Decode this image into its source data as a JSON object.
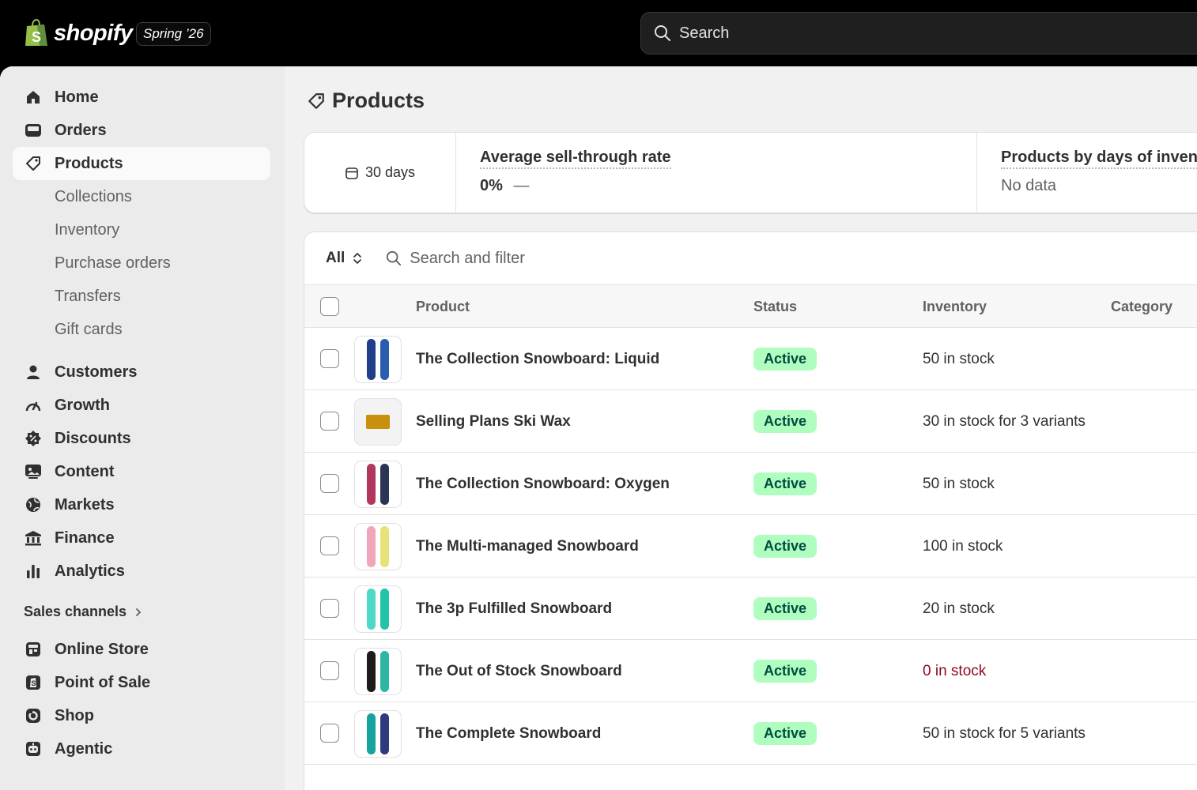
{
  "topbar": {
    "brand": "shopify",
    "edition": "Spring ’26",
    "search_placeholder": "Search"
  },
  "sidebar": {
    "primary": [
      {
        "label": "Home",
        "icon": "home-icon"
      },
      {
        "label": "Orders",
        "icon": "inbox-icon"
      },
      {
        "label": "Products",
        "icon": "tag-icon",
        "active": true
      }
    ],
    "product_subitems": [
      "Collections",
      "Inventory",
      "Purchase orders",
      "Transfers",
      "Gift cards"
    ],
    "secondary": [
      {
        "label": "Customers",
        "icon": "person-icon"
      },
      {
        "label": "Growth",
        "icon": "gauge-icon"
      },
      {
        "label": "Discounts",
        "icon": "discount-icon"
      },
      {
        "label": "Content",
        "icon": "content-icon"
      },
      {
        "label": "Markets",
        "icon": "globe-icon"
      },
      {
        "label": "Finance",
        "icon": "bank-icon"
      },
      {
        "label": "Analytics",
        "icon": "bar-chart-icon"
      }
    ],
    "sales_channels_label": "Sales channels",
    "channels": [
      {
        "label": "Online Store",
        "icon": "store-icon"
      },
      {
        "label": "Point of Sale",
        "icon": "pos-icon"
      },
      {
        "label": "Shop",
        "icon": "shop-icon"
      },
      {
        "label": "Agentic",
        "icon": "robot-icon"
      }
    ]
  },
  "page": {
    "title": "Products"
  },
  "metrics": {
    "period": "30 days",
    "sell_through_label": "Average sell-through rate",
    "sell_through_value": "0%",
    "sell_through_trend": "—",
    "days_inventory_label": "Products by days of invent",
    "days_inventory_value": "No data"
  },
  "table": {
    "view": "All",
    "search_placeholder": "Search and filter",
    "columns": {
      "product": "Product",
      "status": "Status",
      "inventory": "Inventory",
      "category": "Category"
    },
    "rows": [
      {
        "name": "The Collection Snowboard: Liquid",
        "status": "Active",
        "inventory": "50 in stock",
        "thumb": [
          "#1f3f8a",
          "#2a5cb0"
        ]
      },
      {
        "name": "Selling Plans Ski Wax",
        "status": "Active",
        "inventory": "30 in stock for 3 variants",
        "thumb": [
          "#c8900c"
        ]
      },
      {
        "name": "The Collection Snowboard: Oxygen",
        "status": "Active",
        "inventory": "50 in stock",
        "thumb": [
          "#b2375e",
          "#2b3452"
        ]
      },
      {
        "name": "The Multi-managed Snowboard",
        "status": "Active",
        "inventory": "100 in stock",
        "thumb": [
          "#f0a6b8",
          "#e6e37a"
        ]
      },
      {
        "name": "The 3p Fulfilled Snowboard",
        "status": "Active",
        "inventory": "20 in stock",
        "thumb": [
          "#4ed8c6",
          "#22c3a8"
        ]
      },
      {
        "name": "The Out of Stock Snowboard",
        "status": "Active",
        "inventory": "0 in stock",
        "thumb": [
          "#1c1c1c",
          "#2db6a3"
        ],
        "out_of_stock": true
      },
      {
        "name": "The Complete Snowboard",
        "status": "Active",
        "inventory": "50 in stock for 5 variants",
        "thumb": [
          "#17a3a0",
          "#2e3a7c"
        ]
      }
    ]
  }
}
